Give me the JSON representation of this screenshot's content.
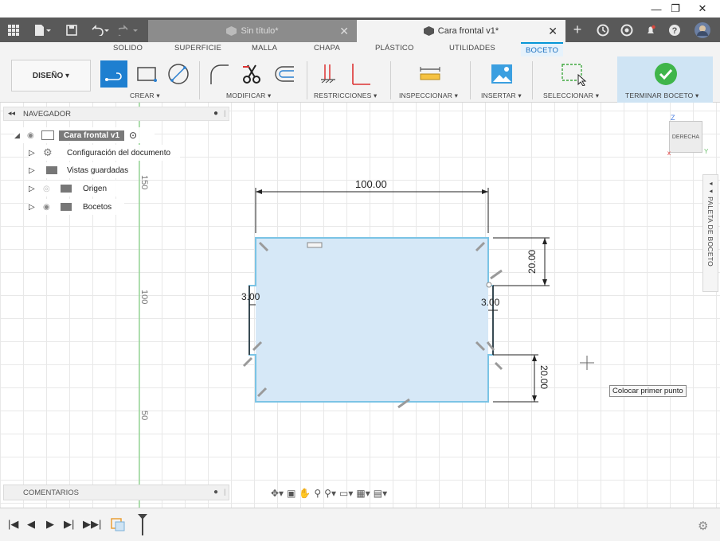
{
  "window": {
    "minimize": "—",
    "restore": "❐",
    "close": "✕"
  },
  "tabs": [
    {
      "label": "Sin título*",
      "close": "✕"
    },
    {
      "label": "Cara frontal v1*",
      "close": "✕"
    }
  ],
  "ribbon": {
    "tabs": [
      "SOLIDO",
      "SUPERFICIE",
      "MALLA",
      "CHAPA",
      "PLÁSTICO",
      "UTILIDADES",
      "BOCETO"
    ],
    "active_tab": "BOCETO",
    "workspace": "DISEÑO ▾",
    "groups": {
      "crear": "CREAR ▾",
      "modificar": "MODIFICAR ▾",
      "restricciones": "RESTRICCIONES ▾",
      "inspeccionar": "INSPECCIONAR ▾",
      "insertar": "INSERTAR ▾",
      "seleccionar": "SELECCIONAR ▾",
      "terminar": "TERMINAR BOCETO ▾"
    }
  },
  "navigator": {
    "title": "NAVEGADOR",
    "root": "Cara frontal v1",
    "items": [
      {
        "label": "Configuración del documento"
      },
      {
        "label": "Vistas guardadas"
      },
      {
        "label": "Origen"
      },
      {
        "label": "Bocetos"
      }
    ]
  },
  "comments": {
    "title": "COMENTARIOS"
  },
  "viewcube": {
    "face": "DERECHA",
    "z_axis": "Z",
    "y_axis": "Y"
  },
  "palette": {
    "label": "PALETA DE BOCETO"
  },
  "sketch": {
    "dim_width": "100.00",
    "dim_right_top": "20.00",
    "dim_right_bottom": "20.00",
    "dim_left_gap": "3.00",
    "dim_right_gap": "3.00",
    "ruler_150": "150",
    "ruler_100": "100",
    "ruler_50": "50",
    "colors": {
      "fill": "#d6e8f7",
      "edge": "#7bc4e5",
      "dim": "#222222",
      "axis_green": "#7fcf7f"
    }
  },
  "tooltip": "Colocar primer punto",
  "timeline": {
    "buttons": [
      "|◀",
      "◀",
      "▶",
      "▶|",
      "▶▶|"
    ]
  }
}
